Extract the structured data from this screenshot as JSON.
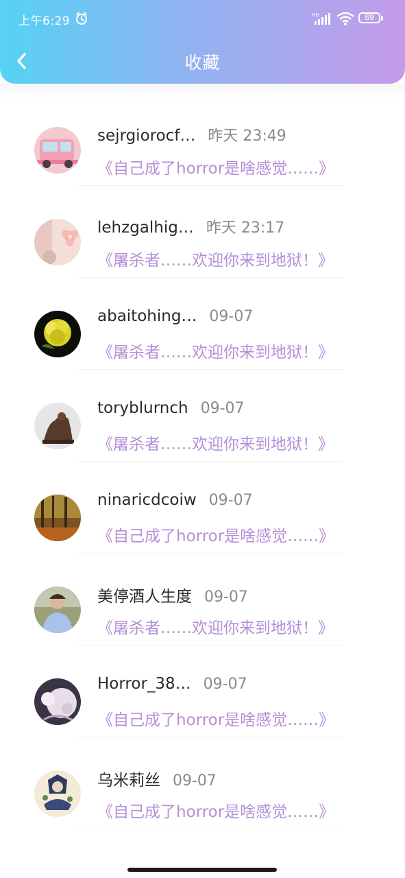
{
  "status_bar": {
    "time": "上午6:29",
    "battery": "89",
    "icons": [
      "alarm-icon",
      "signal-icon",
      "wifi-icon",
      "battery-icon"
    ]
  },
  "header": {
    "title": "收藏",
    "back_icon": "chevron-left-icon"
  },
  "colors": {
    "header_gradient_start": "#55d2f5",
    "header_gradient_end": "#c49be9",
    "link_purple": "#b58fd6",
    "date_gray": "#8a8a8a"
  },
  "items": [
    {
      "name": "sejrgiorocf…",
      "date": "昨天 23:49",
      "title": "《自己成了horror是啥感觉……》",
      "avatar": "avatar-pink-van"
    },
    {
      "name": "lehzgalhig…",
      "date": "昨天 23:17",
      "title": "《屠杀者……欢迎你来到地狱！》",
      "avatar": "avatar-pink-flower"
    },
    {
      "name": "abaitohing…",
      "date": "09-07",
      "title": "《屠杀者……欢迎你来到地狱！》",
      "avatar": "avatar-yellow-flower"
    },
    {
      "name": "toryblurnch",
      "date": "09-07",
      "title": "《屠杀者……欢迎你来到地狱！》",
      "avatar": "avatar-bronze-statue"
    },
    {
      "name": "ninaricdcoiw",
      "date": "09-07",
      "title": "《自己成了horror是啥感觉……》",
      "avatar": "avatar-autumn-forest"
    },
    {
      "name": "美停酒人生度",
      "date": "09-07",
      "title": "《屠杀者……欢迎你来到地狱！》",
      "avatar": "avatar-person-photo"
    },
    {
      "name": "Horror_38…",
      "date": "09-07",
      "title": "《自己成了horror是啥感觉……》",
      "avatar": "avatar-anime-white-hair"
    },
    {
      "name": "乌米莉丝",
      "date": "09-07",
      "title": "《自己成了horror是啥感觉……》",
      "avatar": "avatar-anime-character"
    }
  ]
}
